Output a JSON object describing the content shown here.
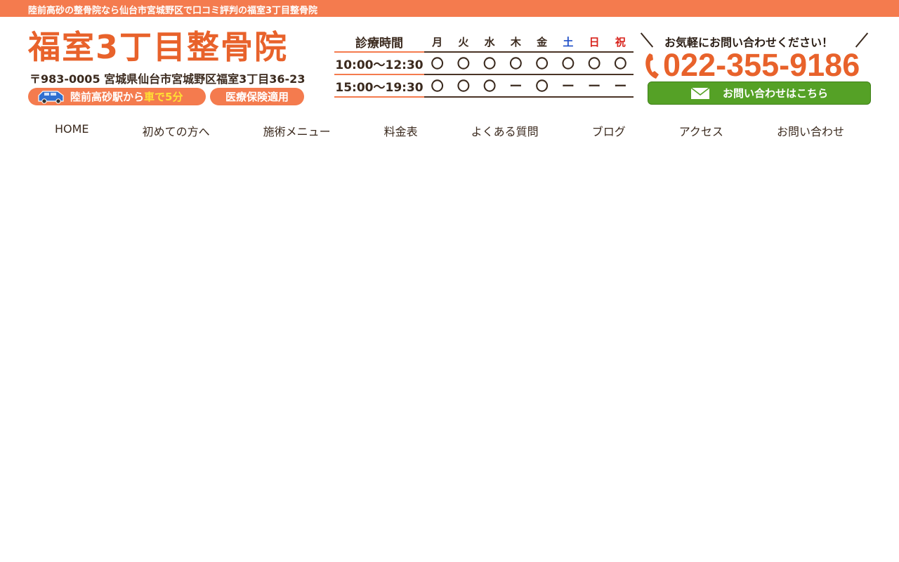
{
  "topbar": {
    "text": "陸前高砂の整骨院なら仙台市宮城野区で口コミ評判の福室3丁目整骨院"
  },
  "logo": {
    "title": "福室3丁目整骨院"
  },
  "address": "〒983-0005 宮城県仙台市宮城野区福室3丁目36-23",
  "access": {
    "prefix": "陸前高砂駅から",
    "highlight": "車で5分"
  },
  "insurance": "医療保険適用",
  "hours": {
    "header_label": "診療時間",
    "days": [
      "月",
      "火",
      "水",
      "木",
      "金",
      "土",
      "日",
      "祝"
    ],
    "rows": [
      {
        "time": "10:00～12:30",
        "marks": [
          "〇",
          "〇",
          "〇",
          "〇",
          "〇",
          "〇",
          "〇",
          "〇"
        ]
      },
      {
        "time": "15:00～19:30",
        "marks": [
          "〇",
          "〇",
          "〇",
          "ー",
          "〇",
          "ー",
          "ー",
          "ー"
        ]
      }
    ]
  },
  "contact": {
    "cta": "お気軽にお問い合わせください！",
    "phone": "022-355-9186",
    "button_label": "お問い合わせはこちら"
  },
  "nav": {
    "items": [
      "HOME",
      "初めての方へ",
      "施術メニュー",
      "料金表",
      "よくある質問",
      "ブログ",
      "アクセス",
      "お問い合わせ"
    ]
  },
  "colors": {
    "accent": "#f47b4e",
    "logo": "#e8622b",
    "button": "#55a126",
    "saturday": "#1f4fc7",
    "sunday": "#d8231c"
  }
}
